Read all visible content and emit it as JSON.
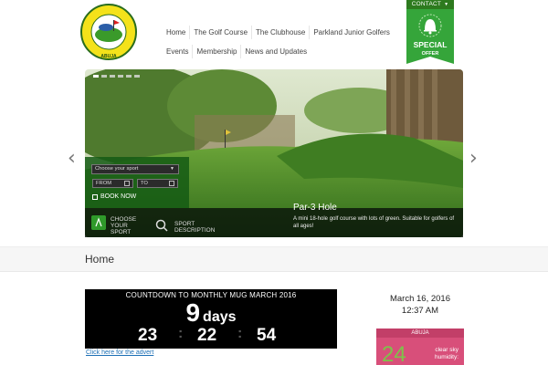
{
  "site": {
    "logo_text": "PARKLAND GOLF RESORT & GARDENS LTD",
    "logo_city": "ABUJA"
  },
  "nav": {
    "row1": [
      "Home",
      "The Golf Course",
      "The Clubhouse",
      "Parkland Junior Golfers"
    ],
    "row2": [
      "Events",
      "Membership",
      "News and Updates"
    ]
  },
  "contact": {
    "label": "CONTACT"
  },
  "special_offer": {
    "line1": "SPECIAL",
    "line2": "OFFER"
  },
  "slider": {
    "prev": "‹",
    "next": "›",
    "caption_title": "Par-3 Hole",
    "caption_text": "A mini 18-hole golf course with lots of green. Suitable for golfers of all ages!"
  },
  "booking": {
    "sport_placeholder": "Choose your sport",
    "from": "FROM",
    "to": "TO",
    "book_now": "BOOK NOW",
    "choose_sport": [
      "CHOOSE",
      "YOUR",
      "SPORT"
    ],
    "sport_description": [
      "SPORT",
      "DESCRIPTION"
    ]
  },
  "page_title": "Home",
  "countdown": {
    "title": "COUNTDOWN TO MONTHLY MUG MARCH 2016",
    "days": "9",
    "days_label": "days",
    "hours": "23",
    "minutes": "22",
    "seconds": "54",
    "sep": ":"
  },
  "advert_link": "Click here for the advert",
  "datetime": {
    "date": "March 16, 2016",
    "time": "12:37 AM"
  },
  "weather": {
    "city": "ABUJA",
    "temp": "24",
    "line1": "clear sky",
    "line2": "humidity:"
  },
  "colors": {
    "brand_green": "#2d7a1e",
    "weather_pink": "#d84f7a",
    "link_blue": "#1c6fb5"
  }
}
